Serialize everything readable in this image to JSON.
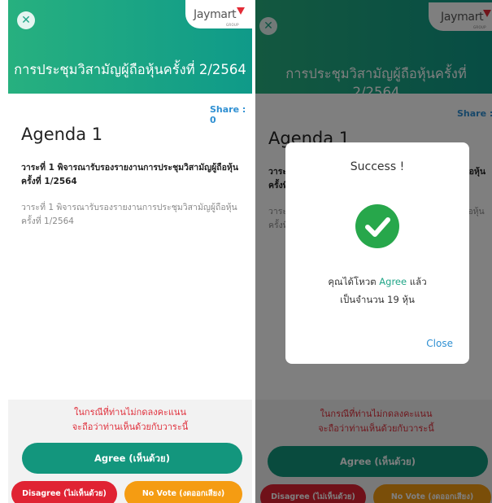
{
  "colors": {
    "header_start": "#27b07f",
    "header_end": "#0f9a89",
    "agree": "#13967d",
    "disagree": "#e02333",
    "novote": "#f59c12",
    "notice_red": "#e0303c",
    "link_blue": "#2e8fd2",
    "success_green": "#27a74b"
  },
  "icons": {
    "close": "close-icon",
    "brand": "jaymart-logo",
    "success": "check-icon"
  },
  "brand": {
    "name": "Jaymart",
    "group": "GROUP"
  },
  "header": {
    "title": "การประชุมวิสามัญผู้ถือหุ้นครั้งที่ 2/2564"
  },
  "agenda": {
    "share_label": "Share : 0",
    "title": "Agenda 1",
    "item_title": "วาระที่ 1 พิจารณารับรองรายงานการประชุมวิสามัญผู้ถือหุ้นครั้งที่ 1/2564",
    "item_desc": "วาระที่ 1 พิจารณารับรองรายงานการประชุมวิสามัญผู้ถือหุ้นครั้งที่ 1/2564"
  },
  "footer": {
    "notice_line1": "ในกรณีที่ท่านไม่กดลงคะแนน",
    "notice_line2": "จะถือว่าท่านเห็นด้วยกับวาระนี้",
    "agree_label": "Agree (เห็นด้วย)",
    "disagree_label": "Disagree (ไม่เห็นด้วย)",
    "novote_label": "No Vote (งดออกเสียง)"
  },
  "modal": {
    "title": "Success !",
    "msg_prefix": "คุณได้โหวต ",
    "msg_vote": "Agree",
    "msg_suffix": " แล้ว",
    "msg_line2": "เป็นจำนวน 19 หุ้น",
    "close_label": "Close"
  }
}
